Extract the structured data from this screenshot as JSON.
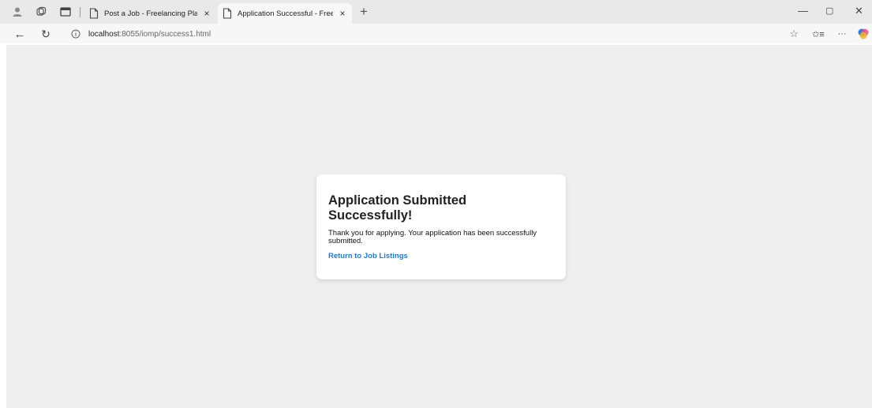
{
  "browser": {
    "tabs": [
      {
        "title": "Post a Job - Freelancing Platform",
        "active": false
      },
      {
        "title": "Application Successful - Freelanci",
        "active": true
      }
    ],
    "address": {
      "host": "localhost",
      "path": ":8055/iomp/success1.html"
    },
    "icons": {
      "profile": "profile-icon",
      "workspaces": "workspaces-icon",
      "vertical_tabs": "vertical-tabs-icon",
      "new_tab": "plus-icon",
      "minimize": "minimize-icon",
      "restore": "restore-icon",
      "close_window": "close-icon",
      "back": "back-arrow-icon",
      "refresh": "refresh-icon",
      "site_info": "info-icon",
      "favorite": "star-icon",
      "favorites": "favorites-icon",
      "more": "more-icon",
      "copilot": "copilot-icon"
    },
    "glyphs": {
      "tab_close": "×",
      "new_tab": "+",
      "minimize": "—",
      "restore": "▢",
      "close": "✕",
      "back": "←",
      "refresh": "↻",
      "star": "☆",
      "favorites": "✩≡",
      "more": "···"
    }
  },
  "page": {
    "heading": "Application Submitted Successfully!",
    "message": "Thank you for applying. Your application has been successfully submitted.",
    "link_label": "Return to Job Listings"
  },
  "colors": {
    "page_background": "#efefef",
    "link": "#1e7bd6",
    "card": "#ffffff"
  }
}
